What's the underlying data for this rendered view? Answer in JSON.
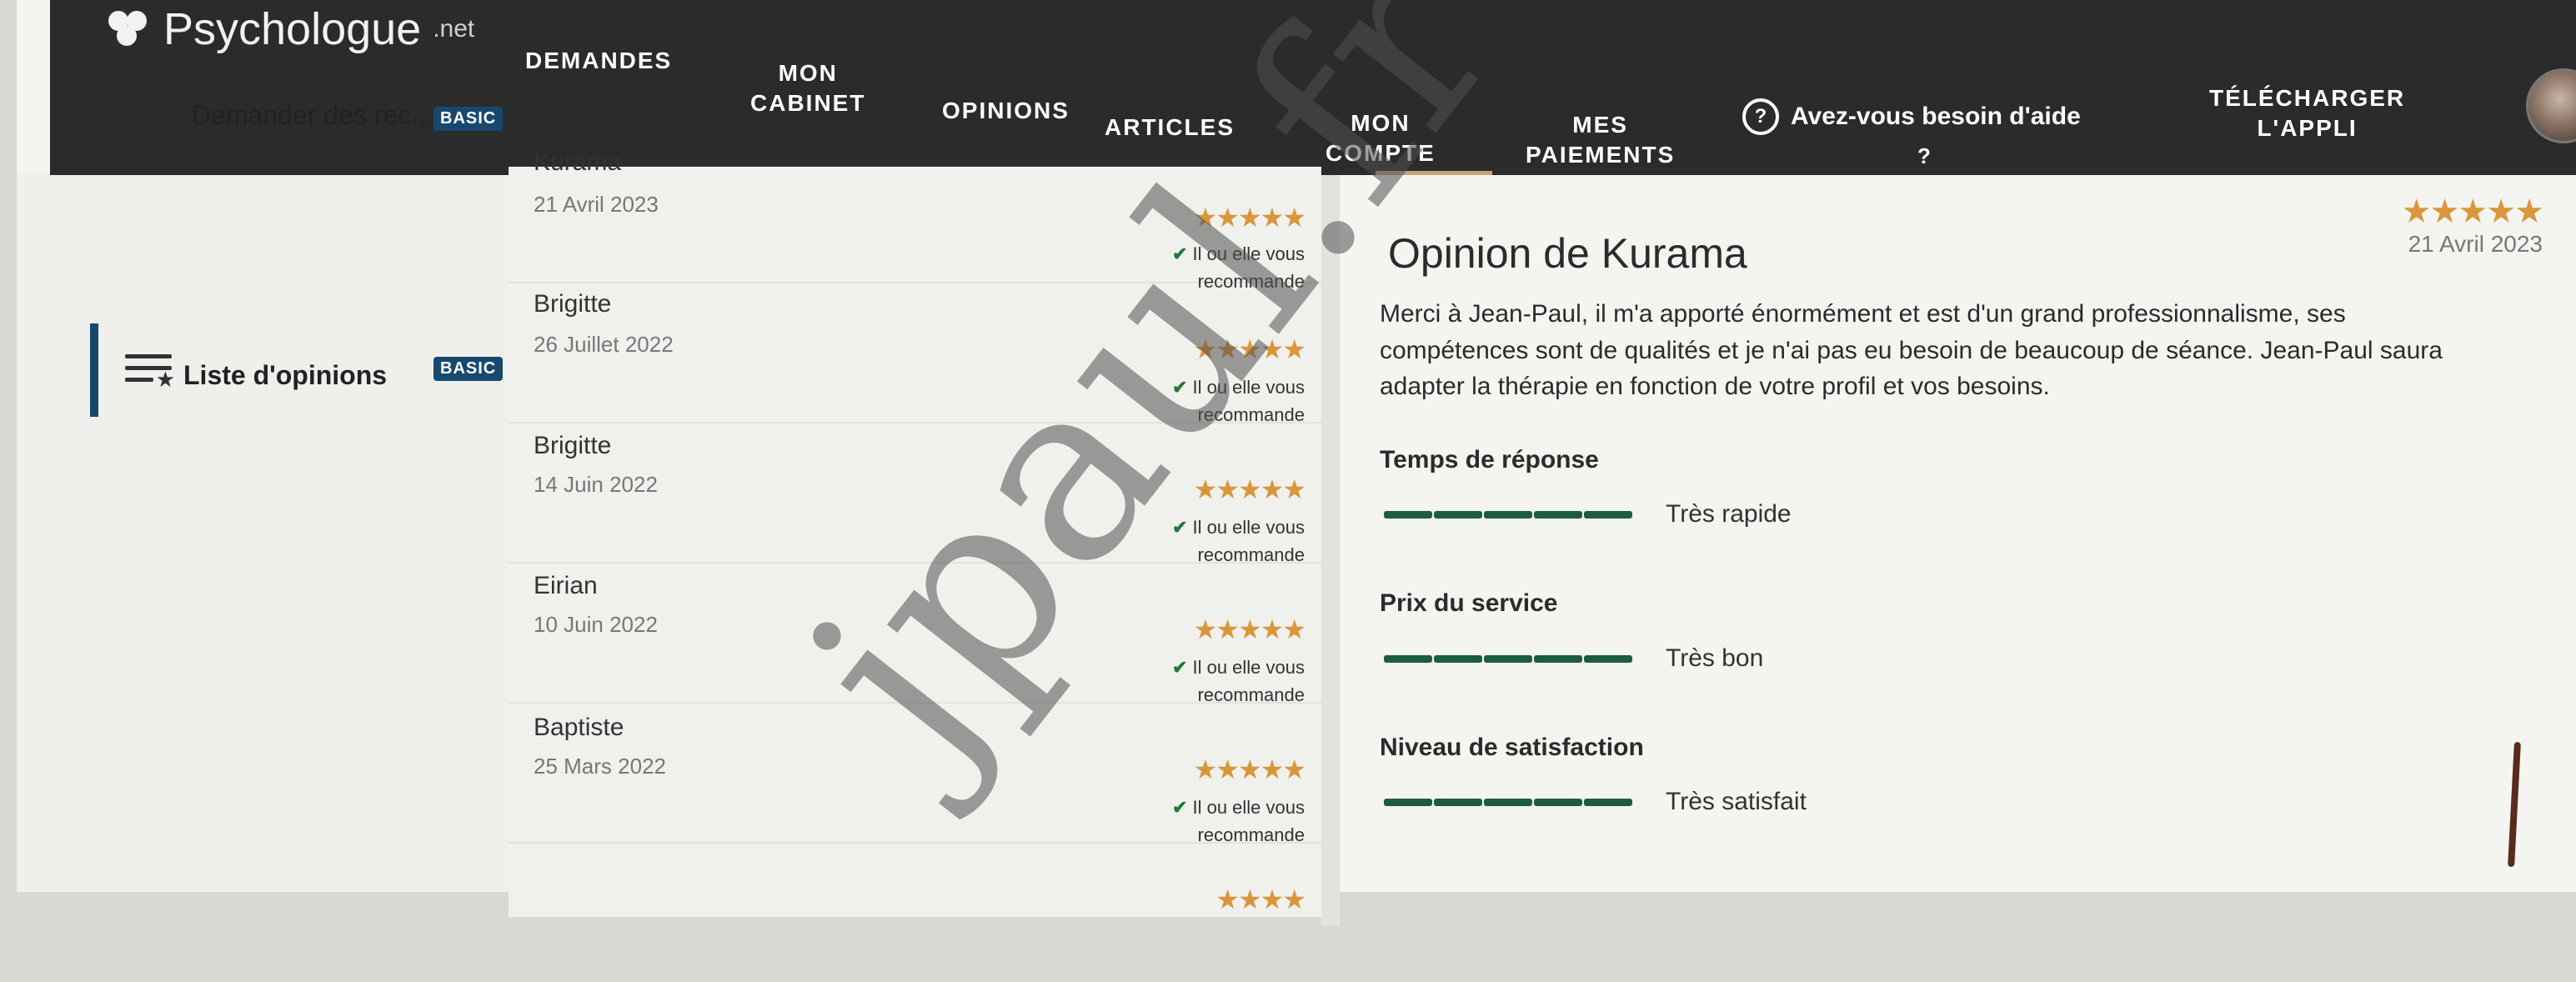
{
  "brand": {
    "name": "Psychologue",
    "suffix": ".net"
  },
  "nav": {
    "items": [
      {
        "id": "demandes",
        "label": "DEMANDES"
      },
      {
        "id": "cabinet",
        "label": "MON\nCABINET"
      },
      {
        "id": "opinions",
        "label": "OPINIONS"
      },
      {
        "id": "articles",
        "label": "ARTICLES"
      },
      {
        "id": "compte",
        "label": "MON\nCOMPTE"
      },
      {
        "id": "paiements",
        "label": "MES\nPAIEMENTS"
      },
      {
        "id": "appli",
        "label": "TÉLÉCHARGER\nL'APPLI"
      }
    ],
    "help_label": "Avez-vous besoin d'aide",
    "help_question": "?"
  },
  "sidebar": {
    "items": [
      {
        "label": "Demander des rec...",
        "badge": "BASIC"
      },
      {
        "label": "Liste d'opinions",
        "badge": "BASIC",
        "icon": "list-star-icon"
      }
    ]
  },
  "reviews": [
    {
      "name": "Kurama",
      "date": "21 Avril 2023",
      "stars": "★★★★★",
      "rec1": "Il ou elle vous",
      "rec2": "recommande"
    },
    {
      "name": "Brigitte",
      "date": "26 Juillet 2022",
      "stars": "★★★★★",
      "rec1": "Il ou elle vous",
      "rec2": "recommande"
    },
    {
      "name": "Brigitte",
      "date": "14 Juin 2022",
      "stars": "★★★★★",
      "rec1": "Il ou elle vous",
      "rec2": "recommande"
    },
    {
      "name": "Eirian",
      "date": "10 Juin 2022",
      "stars": "★★★★★",
      "rec1": "Il ou elle vous",
      "rec2": "recommande"
    },
    {
      "name": "Baptiste",
      "date": "25 Mars 2022",
      "stars": "★★★★★",
      "rec1": "Il ou elle vous",
      "rec2": "recommande"
    },
    {
      "name": "",
      "date": "",
      "stars": "★★★★",
      "rec1": "",
      "rec2": ""
    }
  ],
  "detail": {
    "title": "Opinion de Kurama",
    "stars": "★★★★★",
    "date": "21 Avril 2023",
    "text": "Merci à Jean-Paul, il m'a apporté énormément et est d'un grand professionnalisme, ses compétences sont de qualités et je n'ai pas eu besoin de beaucoup de séance. Jean-Paul saura adapter la thérapie en fonction de votre profil et vos besoins.",
    "criteria": [
      {
        "label": "Temps de réponse",
        "value": "Très rapide",
        "level": 1.0
      },
      {
        "label": "Prix du service",
        "value": "Très bon",
        "level": 1.0
      },
      {
        "label": "Niveau de satisfaction",
        "value": "Très satisfait",
        "level": 1.0
      }
    ]
  },
  "watermark": "jpaul.fr",
  "colors": {
    "nav_bg": "#2b2b2b",
    "badge": "#17496e",
    "stars": "#d9963a",
    "bars": "#1c5c43",
    "check": "#1f7a3c"
  }
}
